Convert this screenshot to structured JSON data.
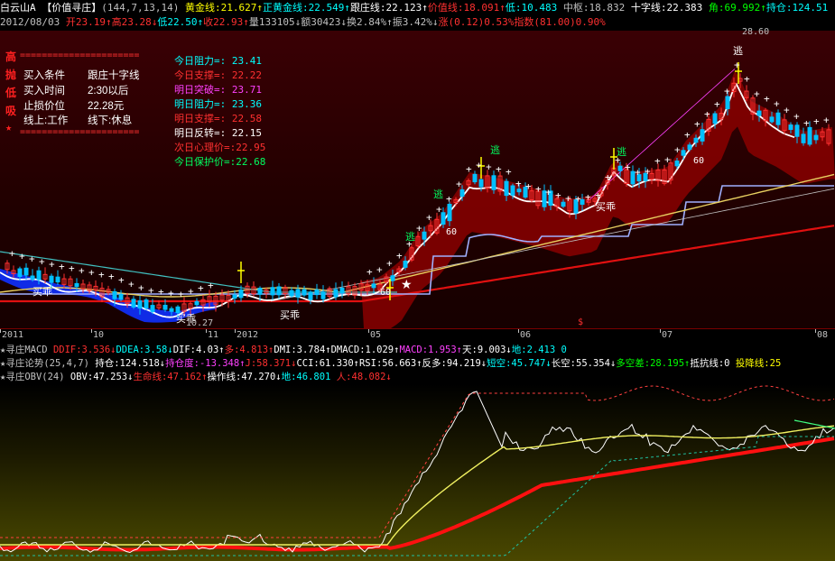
{
  "header": {
    "row1": [
      {
        "t": "白云山A",
        "c": "#ffffff"
      },
      {
        "t": " 【价值寻庄】",
        "c": "#ffffff"
      },
      {
        "t": "(144,7,13,14)",
        "c": "#c0c0c0"
      },
      {
        "t": " 黄金线:21.627↑",
        "c": "#ffff00"
      },
      {
        "t": "正黄金线:22.549↑",
        "c": "#00ffff"
      },
      {
        "t": "跟庄线:22.123↑",
        "c": "#ffffff"
      },
      {
        "t": "价值线:18.091↑",
        "c": "#ff3030"
      },
      {
        "t": "低:10.483 ",
        "c": "#00ffff"
      },
      {
        "t": "中枢:18.832 ",
        "c": "#c0c0c0"
      },
      {
        "t": "十字线:22.383 ",
        "c": "#ffffff"
      },
      {
        "t": "角:69.992↑",
        "c": "#00ff00"
      },
      {
        "t": "持仓:124.51",
        "c": "#00ffff"
      }
    ],
    "row2": [
      {
        "t": "2012/08/03 ",
        "c": "#c0c0c0"
      },
      {
        "t": "开23.19↑",
        "c": "#ff3030"
      },
      {
        "t": "高23.28↓",
        "c": "#ff3030"
      },
      {
        "t": "低22.50↑",
        "c": "#00ffff"
      },
      {
        "t": "收22.93↑",
        "c": "#ff3030"
      },
      {
        "t": "量133105↓",
        "c": "#c0c0c0"
      },
      {
        "t": "额30423↓",
        "c": "#c0c0c0"
      },
      {
        "t": "换2.84%↑",
        "c": "#c0c0c0"
      },
      {
        "t": "振3.42%↓",
        "c": "#c0c0c0"
      },
      {
        "t": "涨(0.12)0.53%",
        "c": "#ff3030"
      },
      {
        "t": "指数(81.00)0.90%",
        "c": "#ff3030"
      }
    ]
  },
  "info_box": {
    "side_chars": [
      "高",
      "抛",
      "低",
      "吸",
      "★"
    ],
    "rule": "======================",
    "conditions": [
      {
        "k": "买入条件",
        "v": "跟庄十字线"
      },
      {
        "k": "买入时间",
        "v": "2:30以后"
      },
      {
        "k": "止损价位",
        "v": "22.28元"
      },
      {
        "k": "线上:工作",
        "v": "线下:休息"
      }
    ]
  },
  "levels": [
    {
      "t": "今日阻力=: 23.41",
      "c": "#00ffff"
    },
    {
      "t": "今日支撑=: 22.22",
      "c": "#ff3030"
    },
    {
      "t": "明日突破=: 23.71",
      "c": "#ff40ff"
    },
    {
      "t": "明日阻力=: 23.36",
      "c": "#00ffff"
    },
    {
      "t": "明日支撑=: 22.58",
      "c": "#ff3030"
    },
    {
      "t": "明日反转=: 22.15",
      "c": "#ffffff"
    },
    {
      "t": "次日心理价=:22.95",
      "c": "#ff3030"
    },
    {
      "t": "今日保护价=:22.68",
      "c": "#00ff60"
    }
  ],
  "chart_labels": {
    "escape": "逃",
    "buy": "买乖",
    "low_price": "10.27",
    "high_price": "28.60",
    "mark_60": "60",
    "mark_s": "$"
  },
  "axis_ticks": [
    "2011",
    "10",
    "11",
    "2012",
    "05",
    "06",
    "07",
    "08"
  ],
  "indicators": {
    "row1": [
      {
        "t": "★寻庄MACD ",
        "c": "#c0c0c0"
      },
      {
        "t": "DDIF:3.536↓",
        "c": "#ff3030"
      },
      {
        "t": "DDEA:3.58↓",
        "c": "#00ffff"
      },
      {
        "t": "DIF:4.03↑",
        "c": "#ffffff"
      },
      {
        "t": "多:4.813↑",
        "c": "#ff3030"
      },
      {
        "t": "DMI:3.784↑",
        "c": "#ffffff"
      },
      {
        "t": "DMACD:1.029↑",
        "c": "#ffffff"
      },
      {
        "t": "MACD:1.953↑",
        "c": "#ff40ff"
      },
      {
        "t": "天:9.003↓",
        "c": "#ffffff"
      },
      {
        "t": "地:2.413 0",
        "c": "#00ffff"
      }
    ],
    "row2": [
      {
        "t": "★寻庄论势(25,4,7) ",
        "c": "#c0c0c0"
      },
      {
        "t": "持仓:124.518↓",
        "c": "#ffffff"
      },
      {
        "t": "持仓度:-13.348↑",
        "c": "#ff40ff"
      },
      {
        "t": "J:58.371↓",
        "c": "#ff3030"
      },
      {
        "t": "CCI:61.330↑",
        "c": "#ffffff"
      },
      {
        "t": "RSI:56.663↑",
        "c": "#ffffff"
      },
      {
        "t": "反多:94.219↓",
        "c": "#ffffff"
      },
      {
        "t": "短空:45.747↓",
        "c": "#00ffff"
      },
      {
        "t": "长空:55.354↓",
        "c": "#ffffff"
      },
      {
        "t": "多空差:28.195↑",
        "c": "#00ff00"
      },
      {
        "t": "抵抗线:0 ",
        "c": "#ffffff"
      },
      {
        "t": "投降线:25",
        "c": "#ffff00"
      }
    ],
    "row3": [
      {
        "t": "★寻庄OBV(24) ",
        "c": "#c0c0c0"
      },
      {
        "t": "OBV:47.253↓",
        "c": "#ffffff"
      },
      {
        "t": "生命线:47.162↑",
        "c": "#ff3030"
      },
      {
        "t": "操作线:47.270↓",
        "c": "#ffffff"
      },
      {
        "t": "地:46.801 ",
        "c": "#00ffff"
      },
      {
        "t": "人:48.082↓",
        "c": "#ff3030"
      }
    ]
  },
  "colors": {
    "up": "#ff3030",
    "down": "#00c0ff",
    "gold": "#ffff00",
    "white": "#ffffff",
    "cyan": "#00ffff",
    "band": "#8a0000",
    "blue_band": "#1030ff",
    "lifeline": "#ff1010"
  }
}
